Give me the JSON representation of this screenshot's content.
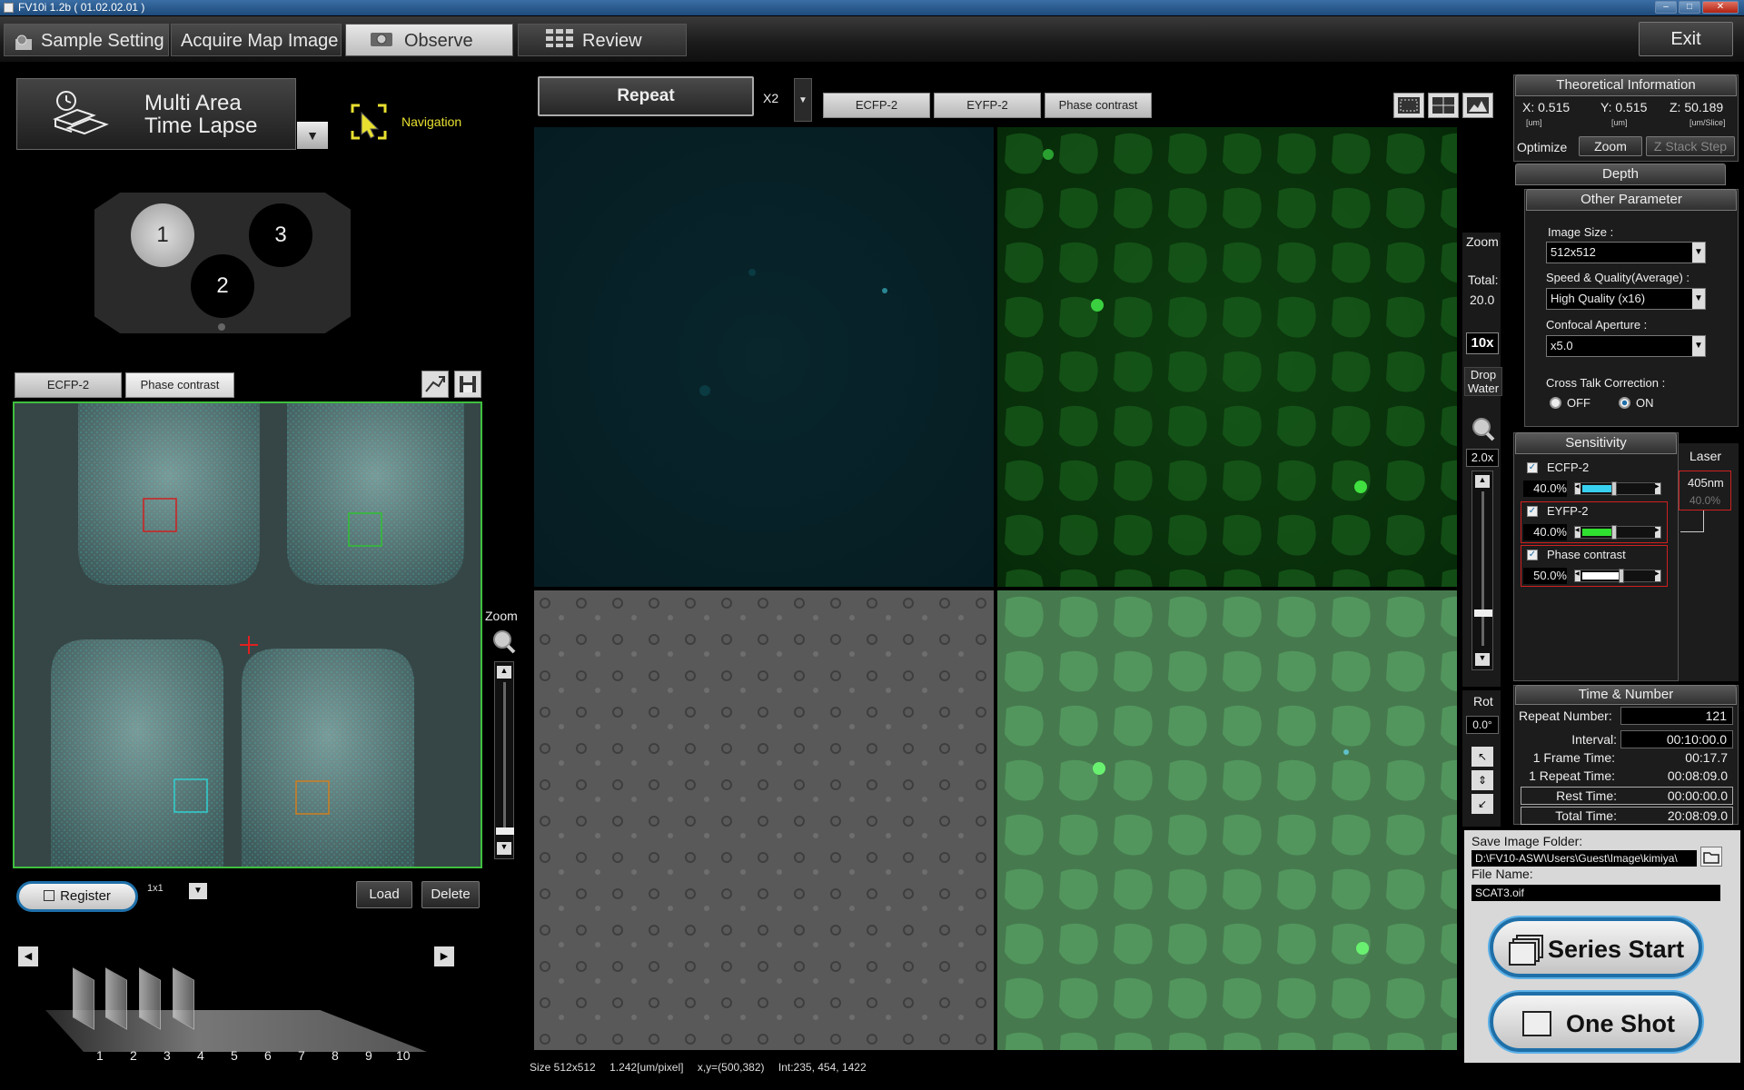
{
  "window": {
    "title": "FV10i 1.2b ( 01.02.02.01 )"
  },
  "menu": {
    "tabs": [
      {
        "label": "Sample Setting"
      },
      {
        "label": "Acquire Map Image"
      },
      {
        "label": "Observe"
      },
      {
        "label": "Review"
      }
    ],
    "exit_label": "Exit"
  },
  "left": {
    "mode_title_line1": "Multi Area",
    "mode_title_line2": "Time Lapse",
    "navigation_label": "Navigation",
    "wells": [
      "1",
      "2",
      "3"
    ],
    "map_channels": [
      "ECFP-2",
      "Phase contrast"
    ],
    "zoom_label": "Zoom",
    "register_label": "Register",
    "grid_value": "1x1",
    "load_label": "Load",
    "delete_label": "Delete",
    "timeline_numbers": [
      "1",
      "2",
      "3",
      "4",
      "5",
      "6",
      "7",
      "8",
      "9",
      "10"
    ]
  },
  "center": {
    "repeat_label": "Repeat",
    "repeat_multiplier": "X2",
    "channels": [
      "ECFP-2",
      "EYFP-2",
      "Phase contrast"
    ],
    "status": {
      "size": "Size 512x512",
      "pixel": "1.242[um/pixel]",
      "xy": "x,y=(500,382)",
      "int": "Int:235, 454, 1422"
    }
  },
  "zoomcol": {
    "zoom_label": "Zoom",
    "total_label": "Total:",
    "total_value": "20.0",
    "objective": "10x",
    "drop_water": "Drop Water",
    "zoom_value": "2.0x",
    "rot_label": "Rot",
    "rot_value": "0.0°"
  },
  "theoretical": {
    "title": "Theoretical Information",
    "x": "X: 0.515",
    "y": "Y: 0.515",
    "z": "Z: 50.189",
    "x_unit": "[um]",
    "y_unit": "[um]",
    "z_unit": "[um/Slice]",
    "optimize_label": "Optimize",
    "zoom_btn": "Zoom",
    "zstack_btn": "Z Stack Step",
    "depth_label": "Depth"
  },
  "other": {
    "title": "Other Parameter",
    "image_size_label": "Image Size :",
    "image_size_value": "512x512",
    "speed_label": "Speed & Quality(Average) :",
    "speed_value": "High Quality (x16)",
    "aperture_label": "Confocal Aperture :",
    "aperture_value": "x5.0",
    "crosstalk_label": "Cross Talk Correction :",
    "off_label": "OFF",
    "on_label": "ON"
  },
  "sensitivity": {
    "title": "Sensitivity",
    "laser_label": "Laser",
    "channels": [
      {
        "name": "ECFP-2",
        "value": "40.0%",
        "level": 0.4,
        "color": "#38d0f0"
      },
      {
        "name": "EYFP-2",
        "value": "40.0%",
        "level": 0.4,
        "color": "#30e030"
      },
      {
        "name": "Phase contrast",
        "value": "50.0%",
        "level": 0.5,
        "color": "#ffffff"
      }
    ],
    "laser_nm": "405nm",
    "laser_pct": "40.0%"
  },
  "time": {
    "title": "Time & Number",
    "repeat_label": "Repeat Number:",
    "repeat_value": "121",
    "interval_label": "Interval:",
    "interval_value": "00:10:00.0",
    "frame_label": "1 Frame Time:",
    "frame_value": "00:17.7",
    "rtime_label": "1 Repeat Time:",
    "rtime_value": "00:08:09.0",
    "rest_label": "Rest Time:",
    "rest_value": "00:00:00.0",
    "total_label": "Total Time:",
    "total_value": "20:08:09.0"
  },
  "save": {
    "folder_label": "Save Image Folder:",
    "folder_value": "D:\\FV10-ASW\\Users\\Guest\\Image\\kimiya\\",
    "file_label": "File Name:",
    "file_value": "SCAT3.oif",
    "series_label": "Series Start",
    "oneshot_label": "One Shot"
  },
  "colors": {
    "accent": "#1e6fa8",
    "nav": "#e8e030",
    "red_box": "#d02020"
  }
}
